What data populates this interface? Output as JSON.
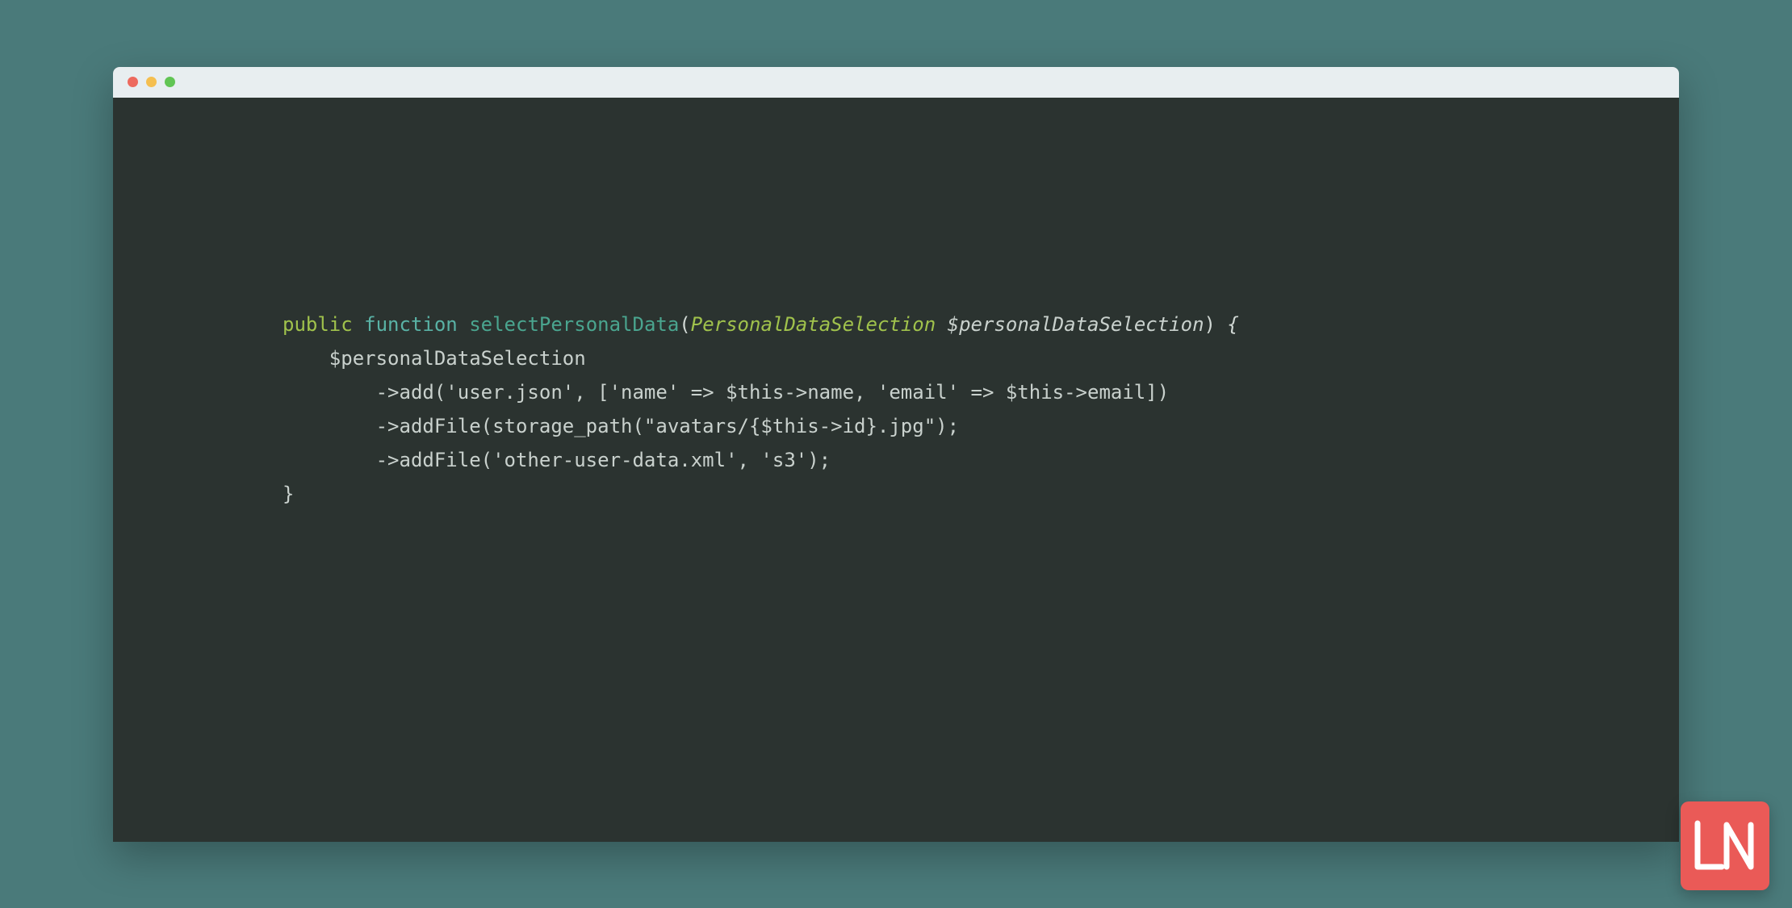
{
  "window": {
    "traffic_lights": {
      "close": "#ed6a5e",
      "minimize": "#f5bf4f",
      "zoom": "#61c554"
    }
  },
  "code": {
    "l1": {
      "kw1": "public",
      "kw2": "function",
      "fn": "selectPersonalData",
      "paren_open": "(",
      "type": "PersonalDataSelection",
      "param": " $personalDataSelection",
      "paren_close": ")",
      "brace_open": " {"
    },
    "l2": "    $personalDataSelection",
    "l3": "        ->add('user.json', ['name' => $this->name, 'email' => $this->email])",
    "l4": "        ->addFile(storage_path(\"avatars/{$this->id}.jpg\");",
    "l5": "        ->addFile('other-user-data.xml', 's3');",
    "l6": "}"
  },
  "logo": {
    "label": "LN",
    "bg": "#ea5a57"
  }
}
